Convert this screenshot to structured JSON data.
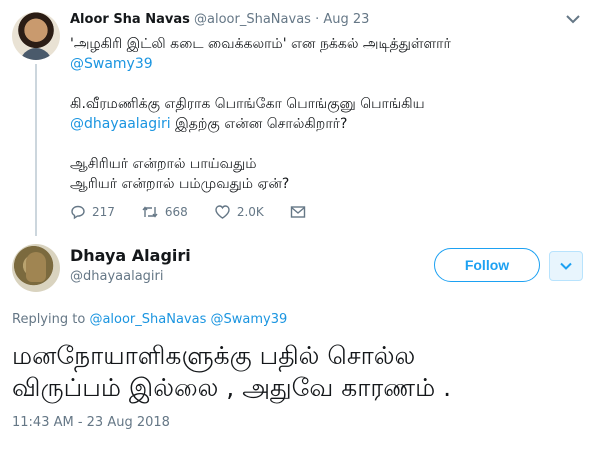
{
  "parent_tweet": {
    "author_name": "Aloor Sha Navas",
    "handle": "@aloor_ShaNavas",
    "separator": "·",
    "date": "Aug 23",
    "lines": [
      "'அழகிரி இட்லி கடை வைக்கலாம்' என நக்கல் அடித்துள்ளார்",
      "@Swamy39",
      "",
      "கி.வீரமணிக்கு எதிராக பொங்கோ பொங்குனு பொங்கிய",
      "@dhayaalagiri இதற்கு என்ன சொல்கிறார்?",
      "",
      "ஆசிரியர் என்றால் பாய்வதும்",
      "ஆரியர் என்றால் பம்முவதும் ஏன்?"
    ],
    "mention_swamy": "@Swamy39",
    "mention_dhaya": "@dhayaalagiri",
    "line5_rest": " இதற்கு என்ன சொல்கிறார்?",
    "stats": {
      "replies": "217",
      "retweets": "668",
      "likes": "2.0K"
    }
  },
  "main_tweet": {
    "author_name": "Dhaya Alagiri",
    "handle": "@dhayaalagiri",
    "follow_label": "Follow",
    "replying_prefix": "Replying to ",
    "replying_to_1": "@aloor_ShaNavas",
    "replying_to_2": "@Swamy39",
    "text_line1": "மனநோயாளிகளுக்கு பதில் சொல்ல",
    "text_line2": "விருப்பம் இல்லை , அதுவே காரணம் .",
    "timestamp": "11:43 AM - 23 Aug 2018"
  },
  "colors": {
    "link": "#1b95e0",
    "accent": "#1da1f2",
    "muted": "#657786",
    "text": "#14171a"
  },
  "icons": [
    "caret-down-icon",
    "reply-icon",
    "retweet-icon",
    "heart-icon",
    "envelope-icon",
    "chevron-down-icon"
  ]
}
